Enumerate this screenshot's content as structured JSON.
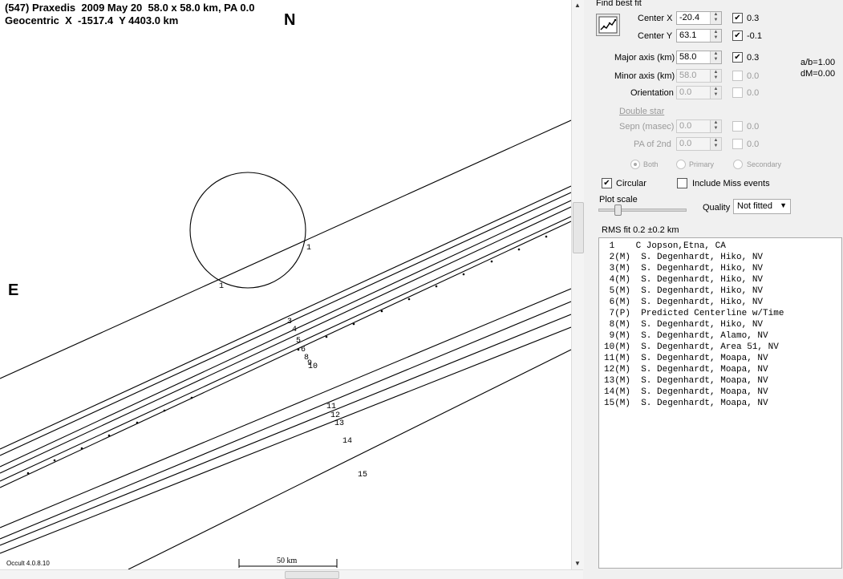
{
  "plot": {
    "header_line1": "(547) Praxedis  2009 May 20  58.0 x 58.0 km, PA 0.0",
    "header_line2": "Geocentric  X  -1517.4  Y 4403.0 km",
    "north_label": "N",
    "east_label": "E",
    "version_text": "Occult 4.0.8.10",
    "scale_label": "50 km",
    "chord_labels": [
      "1",
      "1",
      "3",
      "4",
      "5",
      "6",
      "8",
      "9",
      "10",
      "11",
      "12",
      "13",
      "14",
      "15"
    ]
  },
  "panel": {
    "find_best_fit_label": "Find best fit",
    "center_x_label": "Center X",
    "center_x_value": "-20.4",
    "center_x_step": "0.3",
    "center_y_label": "Center Y",
    "center_y_value": "63.1",
    "center_y_step": "-0.1",
    "major_axis_label": "Major axis (km)",
    "major_axis_value": "58.0",
    "major_axis_step": "0.3",
    "minor_axis_label": "Minor axis (km)",
    "minor_axis_value": "58.0",
    "minor_axis_step": "0.0",
    "orientation_label": "Orientation",
    "orientation_value": "0.0",
    "orientation_step": "0.0",
    "ab_ratio": "a/b=1.00",
    "dm_value": "dM=0.00",
    "double_star_label": "Double star",
    "sepn_label": "Sepn (masec)",
    "sepn_value": "0.0",
    "sepn_step": "0.0",
    "pa2nd_label": "PA of 2nd",
    "pa2nd_value": "0.0",
    "pa2nd_step": "0.0",
    "radio_both": "Both",
    "radio_primary": "Primary",
    "radio_secondary": "Secondary",
    "circular_label": "Circular",
    "include_miss_label": "Include Miss events",
    "plot_scale_label": "Plot scale",
    "quality_label": "Quality",
    "quality_value": "Not fitted",
    "rms_fit_label": "RMS fit 0.2 ±0.2 km"
  },
  "observers": [
    " 1    C Jopson,Etna, CA",
    " 2(M)  S. Degenhardt, Hiko, NV",
    " 3(M)  S. Degenhardt, Hiko, NV",
    " 4(M)  S. Degenhardt, Hiko, NV",
    " 5(M)  S. Degenhardt, Hiko, NV",
    " 6(M)  S. Degenhardt, Hiko, NV",
    " 7(P)  Predicted Centerline w/Time",
    " 8(M)  S. Degenhardt, Hiko, NV",
    " 9(M)  S. Degenhardt, Alamo, NV",
    "10(M)  S. Degenhardt, Area 51, NV",
    "11(M)  S. Degenhardt, Moapa, NV",
    "12(M)  S. Degenhardt, Moapa, NV",
    "13(M)  S. Degenhardt, Moapa, NV",
    "14(M)  S. Degenhardt, Moapa, NV",
    "15(M)  S. Degenhardt, Moapa, NV"
  ]
}
